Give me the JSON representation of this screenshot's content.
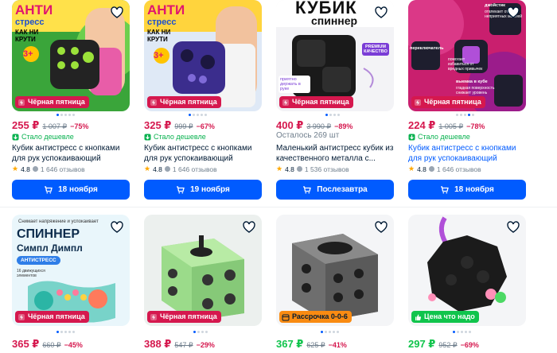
{
  "colors": {
    "accent": "#005bff",
    "price": "#d5184e",
    "green": "#10c44c",
    "orange": "#f98b12",
    "muted": "#707f8d"
  },
  "products": [
    {
      "image_text": {
        "top": "АНТИ",
        "mid": "стресс",
        "bot": "КАК НИ",
        "bot2": "КРУТИ",
        "mult": "3+"
      },
      "badge": "Чёрная пятница",
      "price": "255 ₽",
      "old_price": "1 007 ₽",
      "discount": "−75%",
      "cheaper": "Стало дешевле",
      "title": "Кубик антистресс с кнопками для рук успокаивающий фиджет куб",
      "rating": "4.8",
      "reviews": "1 646 отзывов",
      "button": "18 ноября"
    },
    {
      "image_text": {
        "top": "АНТИ",
        "mid": "стресс",
        "bot": "КАК НИ",
        "bot2": "КРУТИ",
        "mult": "3+"
      },
      "badge": "Чёрная пятница",
      "price": "325 ₽",
      "old_price": "999 ₽",
      "discount": "−67%",
      "cheaper": "Стало дешевле",
      "title": "Кубик антистресс с кнопками для рук успокаивающий фиджет куб",
      "rating": "4.8",
      "reviews": "1 646 отзывов",
      "button": "19 ноября"
    },
    {
      "image_text": {
        "top": "КУБИК",
        "mid": "спиннер",
        "side": "PREMIUM КАЧЕСТВО",
        "note": "приятно держать в руке"
      },
      "badge": "Чёрная пятница",
      "price": "400 ₽",
      "old_price": "3 990 ₽",
      "discount": "−89%",
      "remaining": "Осталось 269 шт",
      "title": "Маленький антистресс кубик из качественного металла с...",
      "rating": "4.8",
      "reviews": "1 536 отзывов",
      "button": "Послезавтра"
    },
    {
      "image_text": {
        "a": "джойстик",
        "b": "отвлекает от неприятных мыслей",
        "c": "переключатель",
        "d": "помогает избавиться от вредных привычек",
        "e": "выемка в кубе",
        "f": "гладкая поверхность снижает уровень стресса"
      },
      "badge": "Чёрная пятница",
      "price": "224 ₽",
      "old_price": "1 005 ₽",
      "discount": "−78%",
      "cheaper": "Стало дешевле",
      "title": "Кубик антистресс с кнопками для рук успокаивающий фиджет куб",
      "rating": "4.8",
      "reviews": "1 646 отзывов",
      "button": "18 ноября"
    },
    {
      "image_text": {
        "top": "Снимает напряжение и успокаивает",
        "big1": "СПИННЕР",
        "big2": "Симпл Димпл",
        "tag": "АНТИСТРЕСС",
        "note": "16 движущихся элементов"
      },
      "badge": "Чёрная пятница",
      "price": "365 ₽",
      "old_price": "660 ₽",
      "discount": "−45%"
    },
    {
      "badge": "Чёрная пятница",
      "price": "388 ₽",
      "old_price": "547 ₽",
      "discount": "−29%"
    },
    {
      "badge": "Рассрочка 0-0-6",
      "price": "367 ₽",
      "old_price": "625 ₽",
      "discount": "−41%"
    },
    {
      "badge": "Цена что надо",
      "price": "297 ₽",
      "old_price": "952 ₽",
      "discount": "−69%"
    }
  ]
}
